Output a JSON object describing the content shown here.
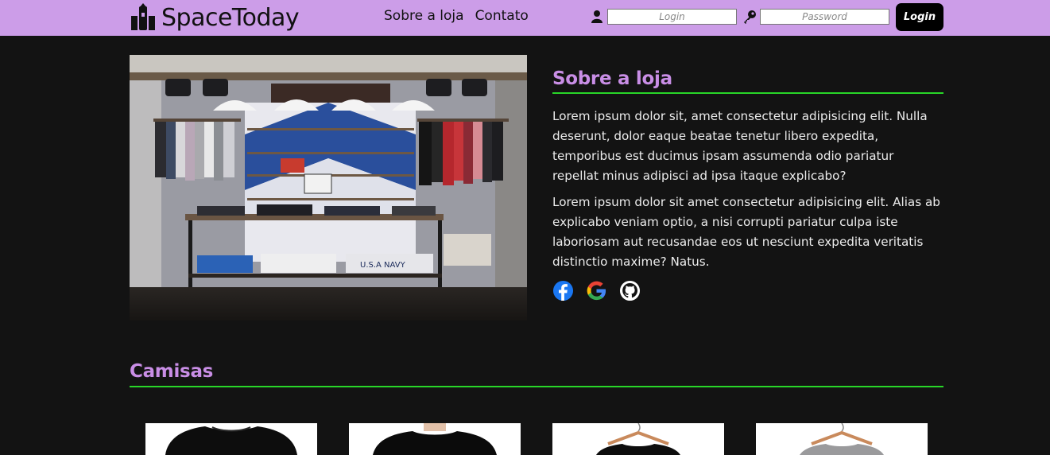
{
  "header": {
    "brand": "SpaceToday",
    "nav": [
      "Sobre a loja",
      "Contato"
    ],
    "login_placeholder": "Login",
    "password_placeholder": "Password",
    "login_button": "Login"
  },
  "about": {
    "title": "Sobre a loja",
    "paragraphs": [
      "Lorem ipsum dolor sit, amet consectetur adipisicing elit. Nulla deserunt, dolor eaque beatae tenetur libero expedita, temporibus est ducimus ipsam assumenda odio pariatur repellat minus adipisci ad ipsa itaque explicabo?",
      "Lorem ipsum dolor sit amet consectetur adipisicing elit. Alias ab explicabo veniam optio, a nisi corrupti pariatur culpa iste laboriosam aut recusandae eos ut nesciunt expedita veritatis distinctio maxime? Natus."
    ],
    "socials": [
      "facebook-icon",
      "google-icon",
      "github-icon"
    ],
    "photo_sign": "U.S.A NAVY"
  },
  "shirts": {
    "title": "Camisas",
    "items": [
      "black-tshirt",
      "black-tshirt-model",
      "black-tshirt-hanger",
      "gray-tshirt-hanger"
    ]
  },
  "colors": {
    "header_bg": "#cc9de8",
    "accent_title": "#c98ee6",
    "rule": "#28d628",
    "page_bg": "#131313"
  }
}
